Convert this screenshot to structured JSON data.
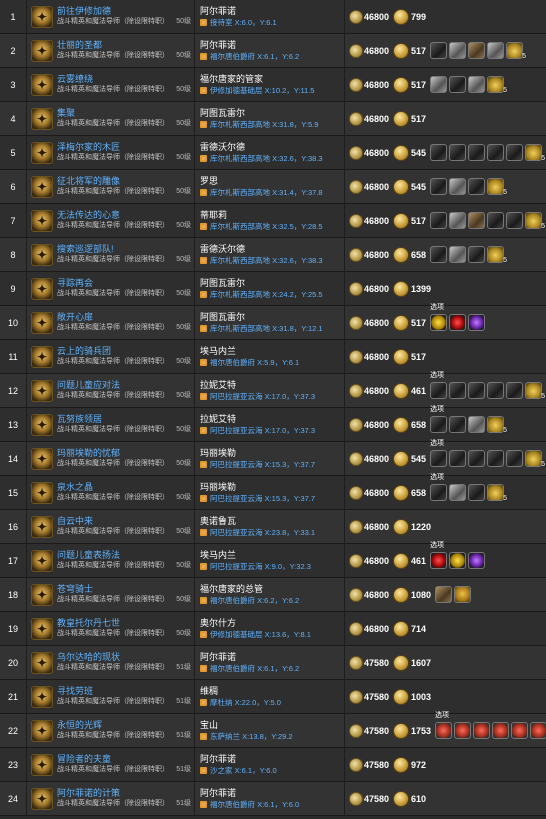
{
  "sub_label": "战斗精英和魔法导师（除设限特职）",
  "option_label": "选项",
  "rows": [
    {
      "num": "1",
      "title": "前往伊修加德",
      "level": "50级",
      "npc": "阿尔菲诺",
      "loc": "接待室 X:6.0，Y:6.1",
      "exp": "46800",
      "gil": "799",
      "items": []
    },
    {
      "num": "2",
      "title": "壮丽的圣都",
      "level": "50级",
      "npc": "阿尔菲诺",
      "loc": "福尔唐伯爵府 X:6.1，Y:6.2",
      "exp": "46800",
      "gil": "517",
      "items": [
        {
          "k": "dark"
        },
        {
          "k": "gear"
        },
        {
          "k": "tool"
        },
        {
          "k": "gear"
        },
        {
          "k": "bag",
          "q": "5"
        }
      ]
    },
    {
      "num": "3",
      "title": "云雾缭绕",
      "level": "50级",
      "npc": "福尔唐家的管家",
      "loc": "伊修加德基础层 X:10.2，Y:11.5",
      "exp": "46800",
      "gil": "517",
      "items": [
        {
          "k": "gear"
        },
        {
          "k": "dark"
        },
        {
          "k": "gear"
        },
        {
          "k": "bag",
          "q": "5"
        }
      ]
    },
    {
      "num": "4",
      "title": "集聚",
      "level": "50级",
      "npc": "阿图瓦雷尔",
      "loc": "库尔札斯西部高地 X:31.8，Y:5.9",
      "exp": "46800",
      "gil": "517",
      "items": []
    },
    {
      "num": "5",
      "title": "泽梅尔家的木匠",
      "level": "50级",
      "npc": "雷德沃尔德",
      "loc": "库尔札斯西部高地 X:32.6，Y:38.3",
      "exp": "46800",
      "gil": "545",
      "items": [
        {
          "k": "dark"
        },
        {
          "k": "dark"
        },
        {
          "k": "dark"
        },
        {
          "k": "dark"
        },
        {
          "k": "dark"
        },
        {
          "k": "bag",
          "q": "5"
        }
      ]
    },
    {
      "num": "6",
      "title": "征北将军的雕像",
      "level": "50级",
      "npc": "罗思",
      "loc": "库尔札斯西部高地 X:31.4，Y:37.8",
      "exp": "46800",
      "gil": "545",
      "items": [
        {
          "k": "dark"
        },
        {
          "k": "gear"
        },
        {
          "k": "dark"
        },
        {
          "k": "bag",
          "q": "5"
        }
      ]
    },
    {
      "num": "7",
      "title": "无法传达的心意",
      "level": "50级",
      "npc": "蒂耶莉",
      "loc": "库尔札斯西部高地 X:32.5，Y:28.5",
      "exp": "46800",
      "gil": "517",
      "items": [
        {
          "k": "dark"
        },
        {
          "k": "gear"
        },
        {
          "k": "tool"
        },
        {
          "k": "dark"
        },
        {
          "k": "dark"
        },
        {
          "k": "bag",
          "q": "5"
        }
      ]
    },
    {
      "num": "8",
      "title": "搜索巡逻部队!",
      "level": "50级",
      "npc": "雷德沃尔德",
      "loc": "库尔札斯西部高地 X:32.6，Y:38.3",
      "exp": "46800",
      "gil": "658",
      "items": [
        {
          "k": "dark"
        },
        {
          "k": "gear"
        },
        {
          "k": "dark"
        },
        {
          "k": "bag",
          "q": "5"
        }
      ]
    },
    {
      "num": "9",
      "title": "寻踪再会",
      "level": "50级",
      "npc": "阿图瓦雷尔",
      "loc": "库尔札斯西部高地 X:24.2，Y:25.5",
      "exp": "46800",
      "gil": "1399",
      "items": []
    },
    {
      "num": "10",
      "title": "敞开心扉",
      "level": "50级",
      "npc": "阿图瓦雷尔",
      "loc": "库尔札斯西部高地 X:31.8，Y:12.1",
      "exp": "46800",
      "gil": "517",
      "items": [
        {
          "k": "gem-y"
        },
        {
          "k": "gem-r"
        },
        {
          "k": "gem-p"
        }
      ],
      "opt": true
    },
    {
      "num": "11",
      "title": "云上的骑兵团",
      "level": "50级",
      "npc": "埃马内兰",
      "loc": "福尔唐伯爵府 X:5.9，Y:6.1",
      "exp": "46800",
      "gil": "517",
      "items": []
    },
    {
      "num": "12",
      "title": "问题儿童应对法",
      "level": "50级",
      "npc": "拉妮艾特",
      "loc": "阿巴拉提亚云海 X:17.0，Y:37.3",
      "exp": "46800",
      "gil": "461",
      "items": [
        {
          "k": "dark"
        },
        {
          "k": "dark"
        },
        {
          "k": "dark"
        },
        {
          "k": "dark"
        },
        {
          "k": "dark"
        },
        {
          "k": "bag",
          "q": "5"
        }
      ],
      "opt": true
    },
    {
      "num": "13",
      "title": "瓦努族领居",
      "level": "50级",
      "npc": "拉妮艾特",
      "loc": "阿巴拉提亚云海 X:17.0，Y:37.3",
      "exp": "46800",
      "gil": "658",
      "items": [
        {
          "k": "dark"
        },
        {
          "k": "dark"
        },
        {
          "k": "gear"
        },
        {
          "k": "bag",
          "q": "5"
        }
      ],
      "opt": true
    },
    {
      "num": "14",
      "title": "玛丽埃勒的忧郁",
      "level": "50级",
      "npc": "玛丽埃勒",
      "loc": "阿巴拉提亚云海 X:15.3，Y:37.7",
      "exp": "46800",
      "gil": "545",
      "items": [
        {
          "k": "dark"
        },
        {
          "k": "dark"
        },
        {
          "k": "dark"
        },
        {
          "k": "dark"
        },
        {
          "k": "dark"
        },
        {
          "k": "bag",
          "q": "5"
        }
      ],
      "opt": true
    },
    {
      "num": "15",
      "title": "泉水之晶",
      "level": "50级",
      "npc": "玛丽埃勒",
      "loc": "阿巴拉提亚云海 X:15.3，Y:37.7",
      "exp": "46800",
      "gil": "658",
      "items": [
        {
          "k": "dark"
        },
        {
          "k": "gear"
        },
        {
          "k": "dark"
        },
        {
          "k": "bag",
          "q": "5"
        }
      ],
      "opt": true
    },
    {
      "num": "16",
      "title": "自云中来",
      "level": "50级",
      "npc": "奥诺鲁瓦",
      "loc": "阿巴拉提亚云海 X:23.8，Y:33.1",
      "exp": "46800",
      "gil": "1220",
      "items": []
    },
    {
      "num": "17",
      "title": "问题儿童表扬法",
      "level": "50级",
      "npc": "埃马内兰",
      "loc": "阿巴拉提亚云海 X:9.0，Y:32.3",
      "exp": "46800",
      "gil": "461",
      "items": [
        {
          "k": "gem-r"
        },
        {
          "k": "gem-y"
        },
        {
          "k": "gem-p"
        }
      ],
      "opt": true
    },
    {
      "num": "18",
      "title": "苍穹骑士",
      "level": "50级",
      "npc": "福尔唐家的总管",
      "loc": "福尔唐伯爵府 X:6.2，Y:6.2",
      "exp": "46800",
      "gil": "1080",
      "items": [
        {
          "k": "tool"
        },
        {
          "k": "chick"
        }
      ]
    },
    {
      "num": "19",
      "title": "教皇托尔丹七世",
      "level": "50级",
      "npc": "奥尔什方",
      "loc": "伊修加德基础层 X:13.6，Y:8.1",
      "exp": "46800",
      "gil": "714",
      "items": []
    },
    {
      "num": "20",
      "title": "乌尔达哈的现状",
      "level": "51级",
      "npc": "阿尔菲诺",
      "loc": "福尔唐伯爵府 X:6.1，Y:6.2",
      "exp": "47580",
      "gil": "1607",
      "items": []
    },
    {
      "num": "21",
      "title": "寻找劳班",
      "level": "51级",
      "npc": "维稠",
      "loc": "摩杜纳 X:22.0，Y:5.0",
      "exp": "47580",
      "gil": "1003",
      "items": []
    },
    {
      "num": "22",
      "title": "永恒的光辉",
      "level": "51级",
      "npc": "宝山",
      "loc": "东萨纳兰 X:13.8，Y:29.2",
      "exp": "47580",
      "gil": "1753",
      "items": [
        {
          "k": "food"
        },
        {
          "k": "food"
        },
        {
          "k": "food"
        },
        {
          "k": "food"
        },
        {
          "k": "food"
        },
        {
          "k": "food"
        }
      ],
      "opt": true
    },
    {
      "num": "23",
      "title": "冒险者的夫童",
      "level": "51级",
      "npc": "阿尔菲诺",
      "loc": "沙之家 X:6.1，Y:6.0",
      "exp": "47580",
      "gil": "972",
      "items": []
    },
    {
      "num": "24",
      "title": "阿尔菲诺的计策",
      "level": "51级",
      "npc": "阿尔菲诺",
      "loc": "福尔唐伯爵府 X:6.1，Y:6.0",
      "exp": "47580",
      "gil": "610",
      "items": []
    }
  ]
}
